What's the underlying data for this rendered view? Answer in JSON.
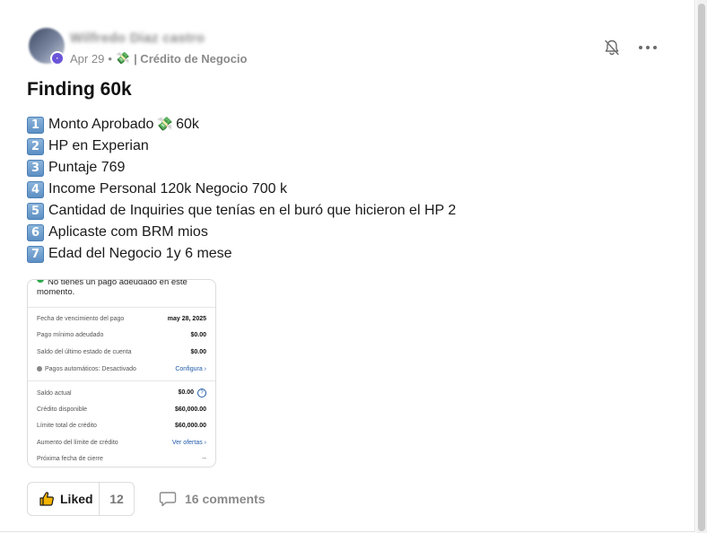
{
  "post": {
    "author": "Wilfredo Diaz castro",
    "date": "Apr 29",
    "separator": "•",
    "category_emoji": "💸",
    "category": "| Crédito de Negocio",
    "title": "Finding 60k",
    "items": [
      {
        "num": "1",
        "text_before": "Monto Aprobado",
        "emoji": "💸",
        "text_after": "60k"
      },
      {
        "num": "2",
        "text_before": "HP en Experian",
        "emoji": "",
        "text_after": ""
      },
      {
        "num": "3",
        "text_before": "Puntaje 769",
        "emoji": "",
        "text_after": ""
      },
      {
        "num": "4",
        "text_before": "Income Personal 120k Negocio 700 k",
        "emoji": "",
        "text_after": ""
      },
      {
        "num": "5",
        "text_before": "Cantidad de Inquiries que tenías en el buró que hicieron el HP 2",
        "emoji": "",
        "text_after": ""
      },
      {
        "num": "6",
        "text_before": "Aplicaste com BRM mios",
        "emoji": "",
        "text_after": ""
      },
      {
        "num": "7",
        "text_before": "Edad del Negocio 1y 6 mese",
        "emoji": "",
        "text_after": ""
      }
    ]
  },
  "attachment": {
    "message": "No tienes un pago adeudado en este momento.",
    "rows": [
      {
        "label": "Fecha de vencimiento del pago",
        "value": "may 28, 2025"
      },
      {
        "label": "Pago mínimo adeudado",
        "value": "$0.00"
      },
      {
        "label": "Saldo del último estado de cuenta",
        "value": "$0.00"
      },
      {
        "label": "Pagos automáticos: Desactivado",
        "value": "Configura ›"
      },
      {
        "label": "Saldo actual",
        "value": "$0.00"
      },
      {
        "label": "Crédito disponible",
        "value": "$60,000.00"
      },
      {
        "label": "Límite total de crédito",
        "value": "$60,000.00"
      },
      {
        "label": "Aumento del límite de crédito",
        "value": "Ver ofertas ›"
      },
      {
        "label": "Próxima fecha de cierre",
        "value": "--"
      }
    ]
  },
  "footer": {
    "like_label": "Liked",
    "like_count": "12",
    "comments_label": "16 comments"
  },
  "icons": {
    "bell": "bell-off-icon",
    "more": "more-horizontal-icon",
    "like": "thumbs-up-icon",
    "comment": "comment-icon",
    "check": "check-circle-icon"
  },
  "colors": {
    "meta_text": "#8a8a8a",
    "keycap": "#5a8dc2",
    "link": "#1f5aa8",
    "check": "#2aa84a"
  }
}
